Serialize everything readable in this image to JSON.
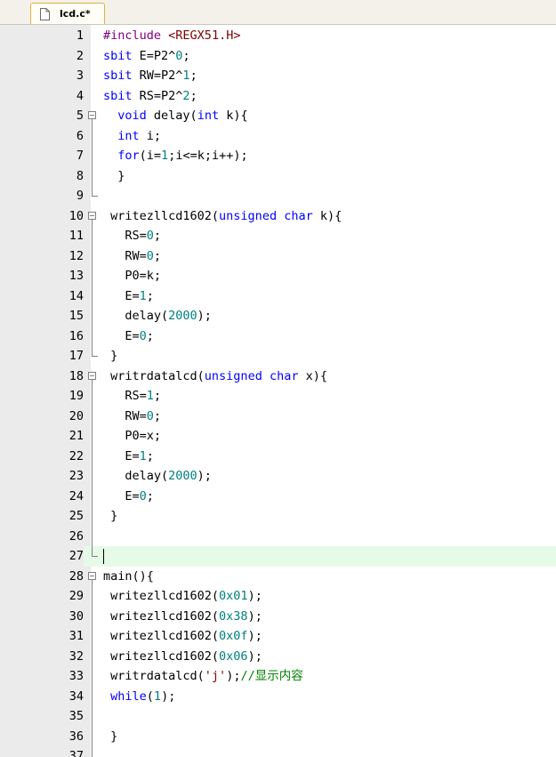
{
  "tab": {
    "label": "lcd.c*"
  },
  "lines": [
    {
      "n": "1",
      "tokens": [
        [
          "#include",
          "pp"
        ],
        [
          " "
        ],
        [
          "<REGX51.H>",
          "str"
        ]
      ]
    },
    {
      "n": "2",
      "tokens": [
        [
          "sbit",
          "kw"
        ],
        [
          " E=P2^"
        ],
        [
          "0",
          "num"
        ],
        [
          ";"
        ]
      ]
    },
    {
      "n": "3",
      "tokens": [
        [
          "sbit",
          "kw"
        ],
        [
          " RW=P2^"
        ],
        [
          "1",
          "num"
        ],
        [
          ";"
        ]
      ]
    },
    {
      "n": "4",
      "tokens": [
        [
          "sbit",
          "kw"
        ],
        [
          " RS=P2^"
        ],
        [
          "2",
          "num"
        ],
        [
          ";"
        ]
      ]
    },
    {
      "n": "5",
      "tokens": [
        [
          "  "
        ],
        [
          "void",
          "kw"
        ],
        [
          " delay("
        ],
        [
          "int",
          "kw"
        ],
        [
          " k){"
        ]
      ]
    },
    {
      "n": "6",
      "tokens": [
        [
          "  "
        ],
        [
          "int",
          "kw"
        ],
        [
          " i;"
        ]
      ]
    },
    {
      "n": "7",
      "tokens": [
        [
          "  "
        ],
        [
          "for",
          "kw"
        ],
        [
          "(i="
        ],
        [
          "1",
          "num"
        ],
        [
          ";i<=k;i++);"
        ]
      ]
    },
    {
      "n": "8",
      "tokens": [
        [
          "  }"
        ]
      ]
    },
    {
      "n": "9",
      "tokens": []
    },
    {
      "n": "10",
      "tokens": [
        [
          " writezllcd1602("
        ],
        [
          "unsigned",
          "kw"
        ],
        [
          " "
        ],
        [
          "char",
          "kw"
        ],
        [
          " k){"
        ]
      ]
    },
    {
      "n": "11",
      "tokens": [
        [
          "   RS="
        ],
        [
          "0",
          "num"
        ],
        [
          ";"
        ]
      ]
    },
    {
      "n": "12",
      "tokens": [
        [
          "   RW="
        ],
        [
          "0",
          "num"
        ],
        [
          ";"
        ]
      ]
    },
    {
      "n": "13",
      "tokens": [
        [
          "   P0=k;"
        ]
      ]
    },
    {
      "n": "14",
      "tokens": [
        [
          "   E="
        ],
        [
          "1",
          "num"
        ],
        [
          ";"
        ]
      ]
    },
    {
      "n": "15",
      "tokens": [
        [
          "   delay("
        ],
        [
          "2000",
          "num"
        ],
        [
          ");"
        ]
      ]
    },
    {
      "n": "16",
      "tokens": [
        [
          "   E="
        ],
        [
          "0",
          "num"
        ],
        [
          ";"
        ]
      ]
    },
    {
      "n": "17",
      "tokens": [
        [
          " }"
        ]
      ]
    },
    {
      "n": "18",
      "tokens": [
        [
          " writrdatalcd("
        ],
        [
          "unsigned",
          "kw"
        ],
        [
          " "
        ],
        [
          "char",
          "kw"
        ],
        [
          " x){"
        ]
      ]
    },
    {
      "n": "19",
      "tokens": [
        [
          "   RS="
        ],
        [
          "1",
          "num"
        ],
        [
          ";"
        ]
      ]
    },
    {
      "n": "20",
      "tokens": [
        [
          "   RW="
        ],
        [
          "0",
          "num"
        ],
        [
          ";"
        ]
      ]
    },
    {
      "n": "21",
      "tokens": [
        [
          "   P0=x;"
        ]
      ]
    },
    {
      "n": "22",
      "tokens": [
        [
          "   E="
        ],
        [
          "1",
          "num"
        ],
        [
          ";"
        ]
      ]
    },
    {
      "n": "23",
      "tokens": [
        [
          "   delay("
        ],
        [
          "2000",
          "num"
        ],
        [
          ");"
        ]
      ]
    },
    {
      "n": "24",
      "tokens": [
        [
          "   E="
        ],
        [
          "0",
          "num"
        ],
        [
          ";"
        ]
      ]
    },
    {
      "n": "25",
      "tokens": [
        [
          " }"
        ]
      ]
    },
    {
      "n": "26",
      "tokens": []
    },
    {
      "n": "27",
      "tokens": [],
      "active": true
    },
    {
      "n": "28",
      "tokens": [
        [
          "main(){"
        ]
      ]
    },
    {
      "n": "29",
      "tokens": [
        [
          " writezllcd1602("
        ],
        [
          "0x01",
          "num"
        ],
        [
          ");"
        ]
      ]
    },
    {
      "n": "30",
      "tokens": [
        [
          " writezllcd1602("
        ],
        [
          "0x38",
          "num"
        ],
        [
          ");"
        ]
      ]
    },
    {
      "n": "31",
      "tokens": [
        [
          " writezllcd1602("
        ],
        [
          "0x0f",
          "num"
        ],
        [
          ");"
        ]
      ]
    },
    {
      "n": "32",
      "tokens": [
        [
          " writezllcd1602("
        ],
        [
          "0x06",
          "num"
        ],
        [
          ");"
        ]
      ]
    },
    {
      "n": "33",
      "tokens": [
        [
          " writrdatalcd("
        ],
        [
          "'j'",
          "str"
        ],
        [
          ");"
        ],
        [
          "//显示内容",
          "cm"
        ]
      ]
    },
    {
      "n": "34",
      "tokens": [
        [
          " "
        ],
        [
          "while",
          "kw"
        ],
        [
          "("
        ],
        [
          "1",
          "num"
        ],
        [
          ");"
        ]
      ]
    },
    {
      "n": "35",
      "tokens": []
    },
    {
      "n": "36",
      "tokens": [
        [
          " }"
        ]
      ]
    },
    {
      "n": "37",
      "tokens": []
    }
  ],
  "colors": {
    "keyword": "#0000ff",
    "number": "#008080",
    "string": "#800000",
    "preprocessor": "#800080",
    "comment": "#008000",
    "active_line": "#e6fbe7"
  },
  "icons": {
    "tab_icon": "file-icon",
    "fold": "fold-minus-icon"
  }
}
